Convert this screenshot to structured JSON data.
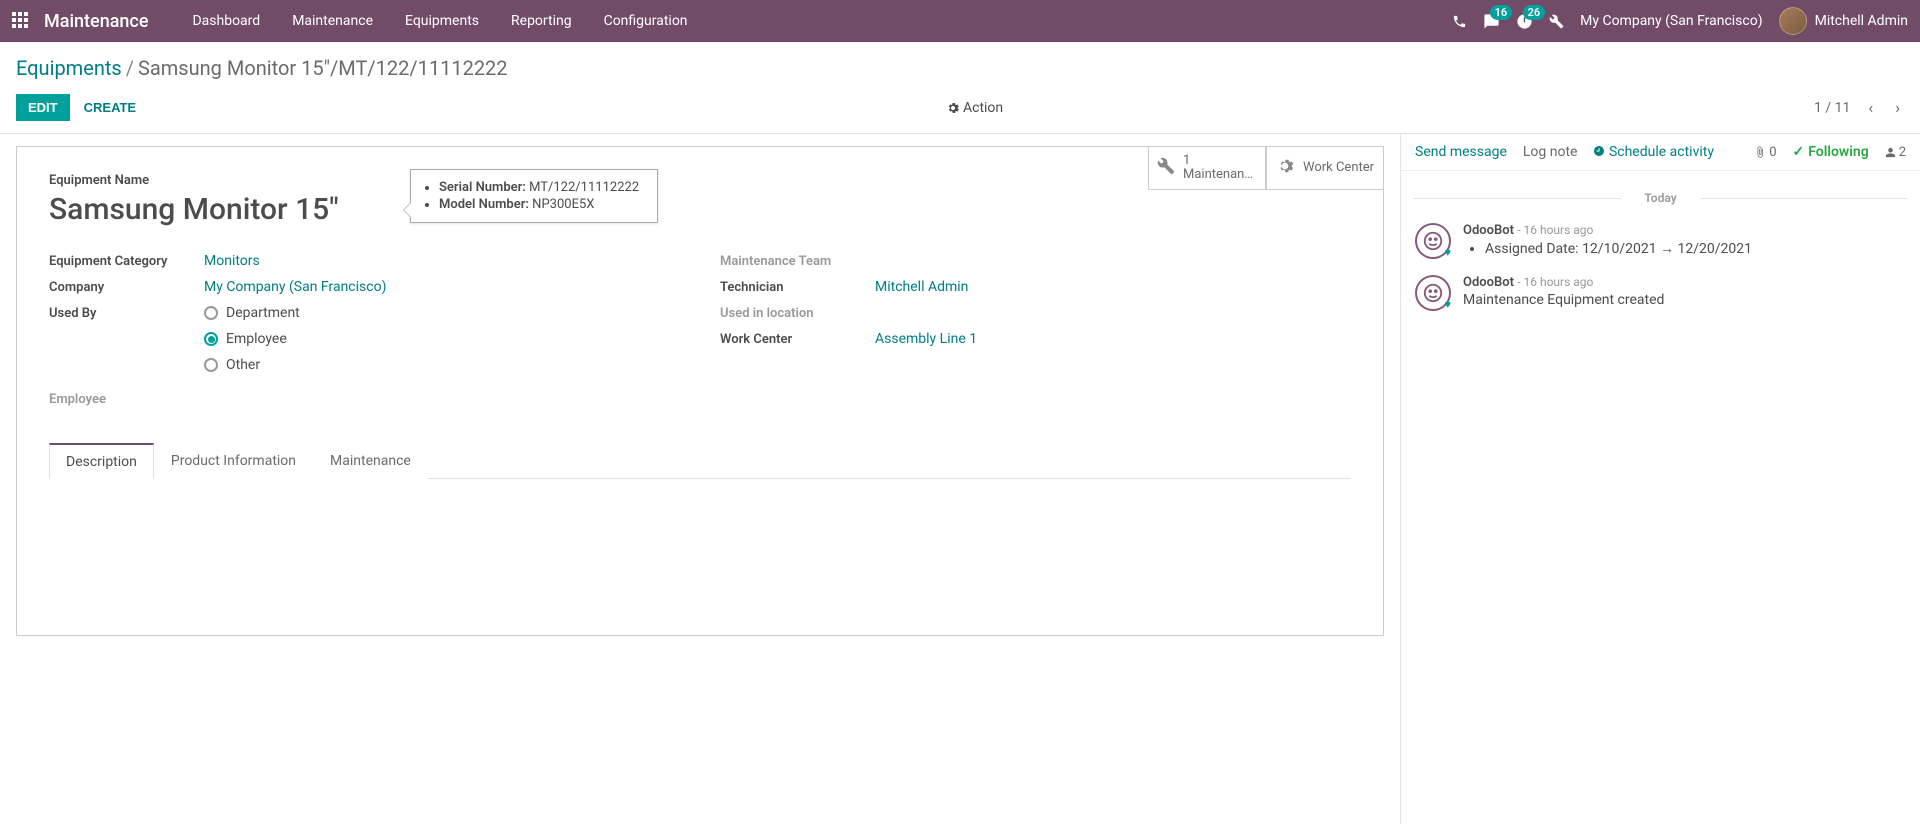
{
  "topbar": {
    "app_name": "Maintenance",
    "menu": [
      "Dashboard",
      "Maintenance",
      "Equipments",
      "Reporting",
      "Configuration"
    ],
    "messaging_badge": "16",
    "activity_badge": "26",
    "company": "My Company (San Francisco)",
    "user": "Mitchell Admin"
  },
  "breadcrumb": {
    "parent": "Equipments",
    "current": "Samsung Monitor 15\"/MT/122/11112222"
  },
  "control": {
    "edit": "EDIT",
    "create": "CREATE",
    "action": "Action",
    "pager": "1 / 11"
  },
  "stat_buttons": {
    "maintenance_count": "1",
    "maintenance_label": "Maintenan…",
    "workcenter_label": "Work Center"
  },
  "tooltip": {
    "serial_label": "Serial Number:",
    "serial_value": "MT/122/11112222",
    "model_label": "Model Number:",
    "model_value": "NP300E5X"
  },
  "form": {
    "name_label": "Equipment Name",
    "name": "Samsung Monitor 15\"",
    "category_label": "Equipment Category",
    "category": "Monitors",
    "company_label": "Company",
    "company": "My Company (San Francisco)",
    "usedby_label": "Used By",
    "usedby_options": {
      "department": "Department",
      "employee": "Employee",
      "other": "Other"
    },
    "employee_label": "Employee",
    "team_label": "Maintenance Team",
    "technician_label": "Technician",
    "technician": "Mitchell Admin",
    "location_label": "Used in location",
    "workcenter_label": "Work Center",
    "workcenter": "Assembly Line 1"
  },
  "tabs": {
    "t1": "Description",
    "t2": "Product Information",
    "t3": "Maintenance"
  },
  "chatter": {
    "send": "Send message",
    "log": "Log note",
    "schedule": "Schedule activity",
    "attachments": "0",
    "following": "Following",
    "followers": "2",
    "date_sep": "Today",
    "msg1": {
      "author": "OdooBot",
      "time": "- 16 hours ago",
      "field": "Assigned Date:",
      "old": "12/10/2021",
      "new": "12/20/2021"
    },
    "msg2": {
      "author": "OdooBot",
      "time": "- 16 hours ago",
      "body": "Maintenance Equipment created"
    }
  }
}
